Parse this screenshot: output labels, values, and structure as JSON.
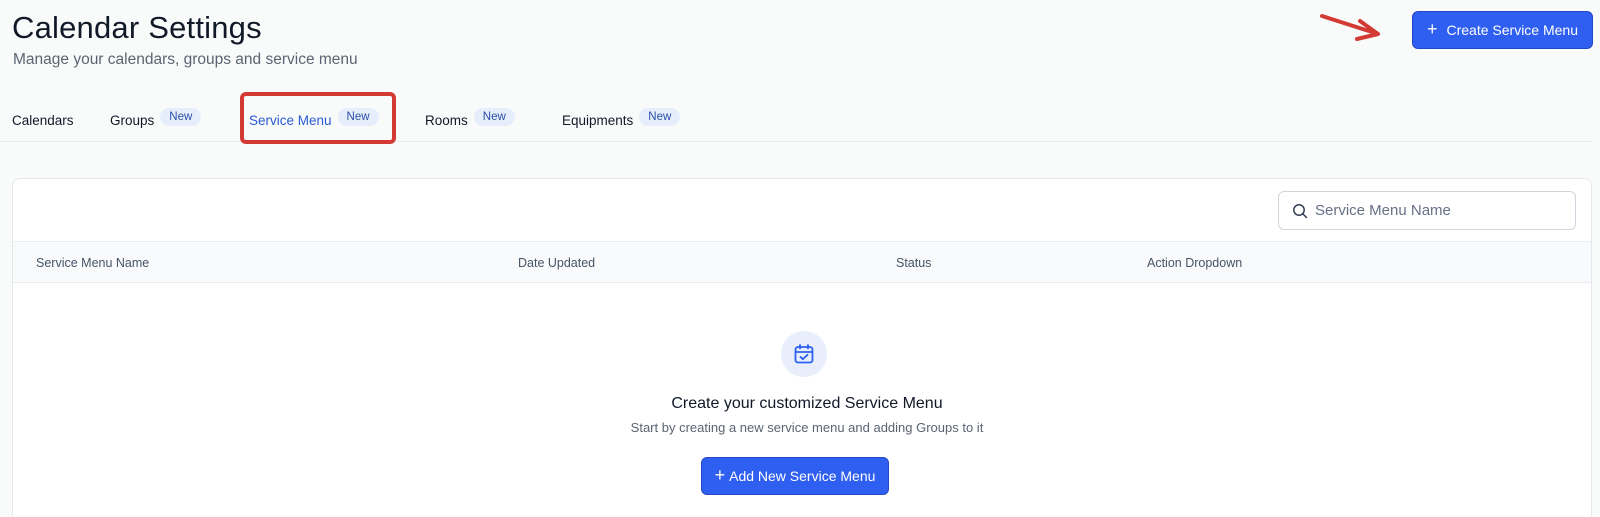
{
  "header": {
    "title": "Calendar Settings",
    "subtitle": "Manage your calendars, groups and service menu",
    "create_button_label": "Create Service Menu"
  },
  "tabs": [
    {
      "label": "Calendars",
      "badge": ""
    },
    {
      "label": "Groups",
      "badge": "New"
    },
    {
      "label": "Service Menu",
      "badge": "New",
      "active": true
    },
    {
      "label": "Rooms",
      "badge": "New"
    },
    {
      "label": "Equipments",
      "badge": "New"
    }
  ],
  "search": {
    "placeholder": "Service Menu Name",
    "value": ""
  },
  "table": {
    "columns": [
      "Service Menu Name",
      "Date Updated",
      "Status",
      "Action Dropdown"
    ],
    "rows": []
  },
  "empty_state": {
    "icon": "calendar-check-icon",
    "title": "Create your customized Service Menu",
    "description": "Start by creating a new service menu and adding Groups to it",
    "button_label": "Add New Service Menu"
  },
  "colors": {
    "primary": "#2f5ff0",
    "active_tab": "#2a5bd6",
    "badge_bg": "#e7eefb",
    "annotation": "#d33a33"
  }
}
